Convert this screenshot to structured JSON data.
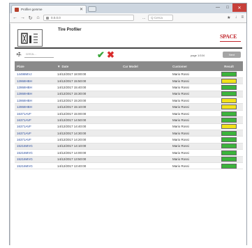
{
  "browser": {
    "tab_title": "Profiler gomme",
    "tab_close": "✕",
    "address": "0.0.0.0",
    "zoom": "...",
    "search_placeholder": "Q Cerca",
    "window_controls": {
      "minimize": "—",
      "maximize": "□",
      "close": "✕"
    }
  },
  "app": {
    "title": "Tire Profiler",
    "brand": "SPACE",
    "search_placeholder": "cerca...",
    "ok_symbol": "✔",
    "cancel_symbol": "✖",
    "pager_text": "page 1/104",
    "pager_button": "Next"
  },
  "table": {
    "columns": {
      "plate": "Plate",
      "date": "Date",
      "car_model": "Car Model",
      "customer": "Customer",
      "result": "Result"
    },
    "rows": [
      {
        "plate": "14498MVJ",
        "date": "14/12/2017 18:00:00",
        "customer": "Mario Rossi",
        "result": "green"
      },
      {
        "plate": "12868HBH",
        "date": "14/12/2017 15:50:00",
        "customer": "Mario Rossi",
        "result": "yellow"
      },
      {
        "plate": "12868HBH",
        "date": "14/12/2017 15:40:00",
        "customer": "Mario Rossi",
        "result": "green"
      },
      {
        "plate": "12868HBH",
        "date": "14/12/2017 15:30:00",
        "customer": "Mario Rossi",
        "result": "green"
      },
      {
        "plate": "12868HBH",
        "date": "14/12/2017 15:20:00",
        "customer": "Mario Rossi",
        "result": "yellow"
      },
      {
        "plate": "12868HBH",
        "date": "14/12/2017 15:10:00",
        "customer": "Mario Rossi",
        "result": "yellow"
      },
      {
        "plate": "16371AVF",
        "date": "14/12/2017 15:00:00",
        "customer": "Mario Rossi",
        "result": "green"
      },
      {
        "plate": "16371AVF",
        "date": "14/12/2017 14:50:00",
        "customer": "Mario Rossi",
        "result": "green"
      },
      {
        "plate": "16371AVF",
        "date": "14/12/2017 14:40:00",
        "customer": "Mario Rossi",
        "result": "yellow"
      },
      {
        "plate": "16371AVF",
        "date": "14/12/2017 14:30:00",
        "customer": "Mario Rossi",
        "result": "green"
      },
      {
        "plate": "16371AVF",
        "date": "14/12/2017 14:20:00",
        "customer": "Mario Rossi",
        "result": "green"
      },
      {
        "plate": "15216MVG",
        "date": "14/12/2017 14:10:00",
        "customer": "Mario Rossi",
        "result": "green"
      },
      {
        "plate": "15216MVG",
        "date": "14/12/2017 14:00:00",
        "customer": "Mario Rossi",
        "result": "green"
      },
      {
        "plate": "15216MVG",
        "date": "14/12/2017 13:50:00",
        "customer": "Mario Rossi",
        "result": "green"
      },
      {
        "plate": "15216MVG",
        "date": "14/12/2017 13:40:00",
        "customer": "Mario Rossi",
        "result": "green"
      }
    ]
  },
  "colors": {
    "green": "#3cb43c",
    "yellow": "#f2e21a",
    "accent_red": "#c1272d",
    "header_gray": "#8a8a8a"
  },
  "icons": {
    "logo": "tire-profiler-logo-icon",
    "wrench": "wrench-icon"
  }
}
